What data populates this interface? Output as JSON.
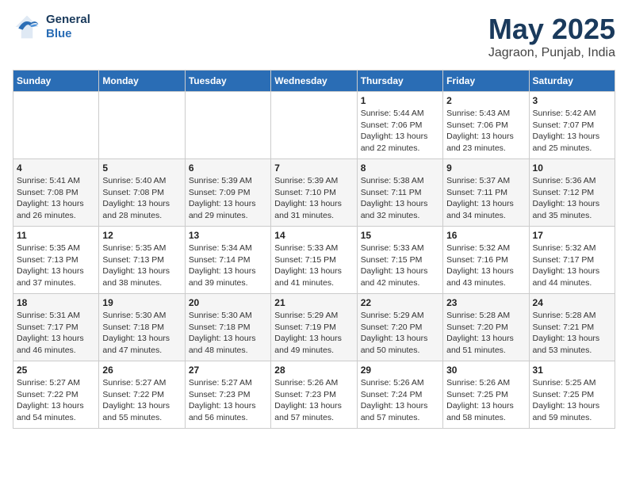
{
  "header": {
    "logo_general": "General",
    "logo_blue": "Blue",
    "title": "May 2025",
    "subtitle": "Jagraon, Punjab, India"
  },
  "days_of_week": [
    "Sunday",
    "Monday",
    "Tuesday",
    "Wednesday",
    "Thursday",
    "Friday",
    "Saturday"
  ],
  "weeks": [
    {
      "days": [
        {
          "num": "",
          "info": ""
        },
        {
          "num": "",
          "info": ""
        },
        {
          "num": "",
          "info": ""
        },
        {
          "num": "",
          "info": ""
        },
        {
          "num": "1",
          "info": "Sunrise: 5:44 AM\nSunset: 7:06 PM\nDaylight: 13 hours\nand 22 minutes."
        },
        {
          "num": "2",
          "info": "Sunrise: 5:43 AM\nSunset: 7:06 PM\nDaylight: 13 hours\nand 23 minutes."
        },
        {
          "num": "3",
          "info": "Sunrise: 5:42 AM\nSunset: 7:07 PM\nDaylight: 13 hours\nand 25 minutes."
        }
      ]
    },
    {
      "days": [
        {
          "num": "4",
          "info": "Sunrise: 5:41 AM\nSunset: 7:08 PM\nDaylight: 13 hours\nand 26 minutes."
        },
        {
          "num": "5",
          "info": "Sunrise: 5:40 AM\nSunset: 7:08 PM\nDaylight: 13 hours\nand 28 minutes."
        },
        {
          "num": "6",
          "info": "Sunrise: 5:39 AM\nSunset: 7:09 PM\nDaylight: 13 hours\nand 29 minutes."
        },
        {
          "num": "7",
          "info": "Sunrise: 5:39 AM\nSunset: 7:10 PM\nDaylight: 13 hours\nand 31 minutes."
        },
        {
          "num": "8",
          "info": "Sunrise: 5:38 AM\nSunset: 7:11 PM\nDaylight: 13 hours\nand 32 minutes."
        },
        {
          "num": "9",
          "info": "Sunrise: 5:37 AM\nSunset: 7:11 PM\nDaylight: 13 hours\nand 34 minutes."
        },
        {
          "num": "10",
          "info": "Sunrise: 5:36 AM\nSunset: 7:12 PM\nDaylight: 13 hours\nand 35 minutes."
        }
      ]
    },
    {
      "days": [
        {
          "num": "11",
          "info": "Sunrise: 5:35 AM\nSunset: 7:13 PM\nDaylight: 13 hours\nand 37 minutes."
        },
        {
          "num": "12",
          "info": "Sunrise: 5:35 AM\nSunset: 7:13 PM\nDaylight: 13 hours\nand 38 minutes."
        },
        {
          "num": "13",
          "info": "Sunrise: 5:34 AM\nSunset: 7:14 PM\nDaylight: 13 hours\nand 39 minutes."
        },
        {
          "num": "14",
          "info": "Sunrise: 5:33 AM\nSunset: 7:15 PM\nDaylight: 13 hours\nand 41 minutes."
        },
        {
          "num": "15",
          "info": "Sunrise: 5:33 AM\nSunset: 7:15 PM\nDaylight: 13 hours\nand 42 minutes."
        },
        {
          "num": "16",
          "info": "Sunrise: 5:32 AM\nSunset: 7:16 PM\nDaylight: 13 hours\nand 43 minutes."
        },
        {
          "num": "17",
          "info": "Sunrise: 5:32 AM\nSunset: 7:17 PM\nDaylight: 13 hours\nand 44 minutes."
        }
      ]
    },
    {
      "days": [
        {
          "num": "18",
          "info": "Sunrise: 5:31 AM\nSunset: 7:17 PM\nDaylight: 13 hours\nand 46 minutes."
        },
        {
          "num": "19",
          "info": "Sunrise: 5:30 AM\nSunset: 7:18 PM\nDaylight: 13 hours\nand 47 minutes."
        },
        {
          "num": "20",
          "info": "Sunrise: 5:30 AM\nSunset: 7:18 PM\nDaylight: 13 hours\nand 48 minutes."
        },
        {
          "num": "21",
          "info": "Sunrise: 5:29 AM\nSunset: 7:19 PM\nDaylight: 13 hours\nand 49 minutes."
        },
        {
          "num": "22",
          "info": "Sunrise: 5:29 AM\nSunset: 7:20 PM\nDaylight: 13 hours\nand 50 minutes."
        },
        {
          "num": "23",
          "info": "Sunrise: 5:28 AM\nSunset: 7:20 PM\nDaylight: 13 hours\nand 51 minutes."
        },
        {
          "num": "24",
          "info": "Sunrise: 5:28 AM\nSunset: 7:21 PM\nDaylight: 13 hours\nand 53 minutes."
        }
      ]
    },
    {
      "days": [
        {
          "num": "25",
          "info": "Sunrise: 5:27 AM\nSunset: 7:22 PM\nDaylight: 13 hours\nand 54 minutes."
        },
        {
          "num": "26",
          "info": "Sunrise: 5:27 AM\nSunset: 7:22 PM\nDaylight: 13 hours\nand 55 minutes."
        },
        {
          "num": "27",
          "info": "Sunrise: 5:27 AM\nSunset: 7:23 PM\nDaylight: 13 hours\nand 56 minutes."
        },
        {
          "num": "28",
          "info": "Sunrise: 5:26 AM\nSunset: 7:23 PM\nDaylight: 13 hours\nand 57 minutes."
        },
        {
          "num": "29",
          "info": "Sunrise: 5:26 AM\nSunset: 7:24 PM\nDaylight: 13 hours\nand 57 minutes."
        },
        {
          "num": "30",
          "info": "Sunrise: 5:26 AM\nSunset: 7:25 PM\nDaylight: 13 hours\nand 58 minutes."
        },
        {
          "num": "31",
          "info": "Sunrise: 5:25 AM\nSunset: 7:25 PM\nDaylight: 13 hours\nand 59 minutes."
        }
      ]
    }
  ]
}
